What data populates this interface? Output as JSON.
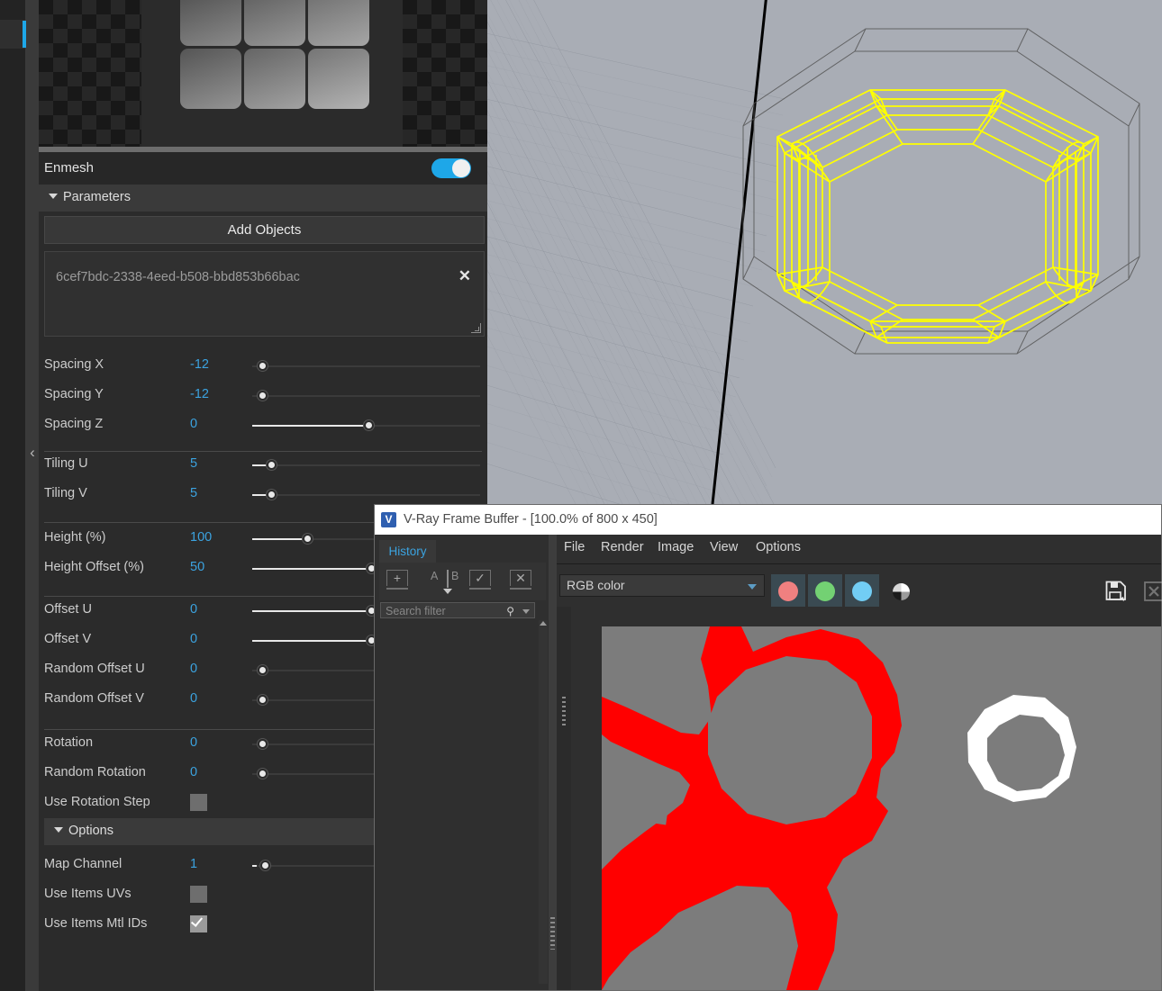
{
  "app": {
    "panel_title": "Enmesh",
    "toggle_state": "on"
  },
  "sections": {
    "parameters": "Parameters",
    "options": "Options"
  },
  "objects": {
    "add_button": "Add Objects",
    "items": [
      "6cef7bdc-2338-4eed-b508-bbd853b66bac"
    ],
    "remove_glyph": "✕"
  },
  "params": [
    {
      "label": "Spacing X",
      "value": "-12",
      "fill": 0,
      "knob": 4
    },
    {
      "label": "Spacing Y",
      "value": "-12",
      "fill": 0,
      "knob": 4
    },
    {
      "label": "Spacing Z",
      "value": "0",
      "fill": 51,
      "knob": 51
    },
    {
      "label": "Tiling U",
      "value": "5",
      "fill": 8,
      "knob": 8
    },
    {
      "label": "Tiling V",
      "value": "5",
      "fill": 8,
      "knob": 8
    },
    {
      "label": "Height (%)",
      "value": "100",
      "fill": 23,
      "knob": 23
    },
    {
      "label": "Height Offset (%)",
      "value": "50",
      "fill": 50,
      "knob": 50
    },
    {
      "label": "Offset U",
      "value": "0",
      "fill": 50,
      "knob": 50
    },
    {
      "label": "Offset V",
      "value": "0",
      "fill": 50,
      "knob": 50
    },
    {
      "label": "Random Offset U",
      "value": "0",
      "fill": 0,
      "knob": 4
    },
    {
      "label": "Random Offset V",
      "value": "0",
      "fill": 0,
      "knob": 4
    },
    {
      "label": "Rotation",
      "value": "0",
      "fill": 0,
      "knob": 4
    },
    {
      "label": "Random Rotation",
      "value": "0",
      "fill": 0,
      "knob": 4
    }
  ],
  "checkboxes": [
    {
      "label": "Use Rotation Step",
      "checked": false
    },
    {
      "label": "Use Items UVs",
      "checked": false
    },
    {
      "label": "Use Items Mtl IDs",
      "checked": true
    }
  ],
  "options_params": [
    {
      "label": "Map Channel",
      "value": "1",
      "fill": 2,
      "knob": 4
    }
  ],
  "vfb": {
    "logo_letter": "V",
    "title": "V-Ray Frame Buffer - [100.0% of 800 x 450]",
    "menus": [
      "File",
      "Render",
      "Image",
      "View",
      "Options"
    ],
    "history": {
      "tab_label": "History",
      "search_placeholder": "Search filter",
      "toolbar_icons": [
        "add-history-icon",
        "ab-compare-icon",
        "check-history-icon",
        "delete-history-icon"
      ],
      "ab_label_a": "A",
      "ab_label_b": "B"
    },
    "channel_select": {
      "value": "RGB color"
    },
    "channel_buttons": [
      {
        "name": "red-channel-button",
        "color": "#f08080"
      },
      {
        "name": "green-channel-button",
        "color": "#73d173"
      },
      {
        "name": "blue-channel-button",
        "color": "#72cdf4"
      }
    ],
    "toolbar_icons": [
      "monochrome-icon",
      "save-image-icon",
      "clear-image-icon"
    ]
  },
  "viewport": {
    "wire_color": "#ffff00",
    "bbox_color": "#555555",
    "bg_color": "#a9adb5",
    "axis_color": "#000000"
  },
  "render": {
    "bg_color": "#7c7c7c",
    "shape_color": "#ff0000",
    "ring_color": "#ffffff"
  },
  "texture": {
    "tile_count": 6
  }
}
